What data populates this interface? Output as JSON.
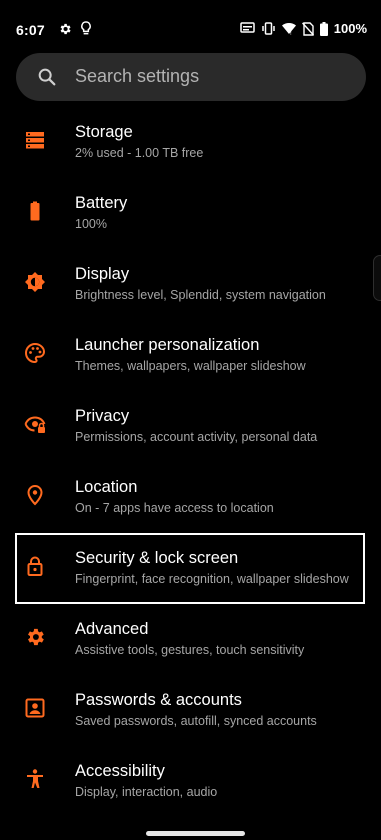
{
  "status_bar": {
    "time": "6:07",
    "battery_percent": "100%",
    "icons": [
      "gear-icon",
      "lightbulb-icon",
      "cast-icon",
      "vibrate-icon",
      "wifi-icon",
      "no-sim-icon",
      "battery-icon"
    ]
  },
  "search": {
    "placeholder": "Search settings"
  },
  "colors": {
    "accent": "#ff6a1f",
    "background": "#000000",
    "search_bg": "#2a2a2a",
    "title": "#ffffff",
    "subtitle": "#a6a6a6"
  },
  "settings": [
    {
      "title": "Storage",
      "subtitle": "2% used - 1.00 TB free",
      "icon": "storage-icon"
    },
    {
      "title": "Battery",
      "subtitle": "100%",
      "icon": "battery-icon"
    },
    {
      "title": "Display",
      "subtitle": "Brightness level, Splendid, system navigation",
      "icon": "brightness-icon"
    },
    {
      "title": "Launcher personalization",
      "subtitle": "Themes, wallpapers, wallpaper slideshow",
      "icon": "palette-icon"
    },
    {
      "title": "Privacy",
      "subtitle": "Permissions, account activity, personal data",
      "icon": "privacy-eye-icon"
    },
    {
      "title": "Location",
      "subtitle": "On - 7 apps have access to location",
      "icon": "location-pin-icon"
    },
    {
      "title": "Security & lock screen",
      "subtitle": "Fingerprint, face recognition, wallpaper slideshow",
      "icon": "lock-icon",
      "selected": true
    },
    {
      "title": "Advanced",
      "subtitle": "Assistive tools, gestures, touch sensitivity",
      "icon": "advanced-gear-icon"
    },
    {
      "title": "Passwords & accounts",
      "subtitle": "Saved passwords, autofill, synced accounts",
      "icon": "account-box-icon"
    },
    {
      "title": "Accessibility",
      "subtitle": "Display, interaction, audio",
      "icon": "accessibility-icon"
    }
  ]
}
